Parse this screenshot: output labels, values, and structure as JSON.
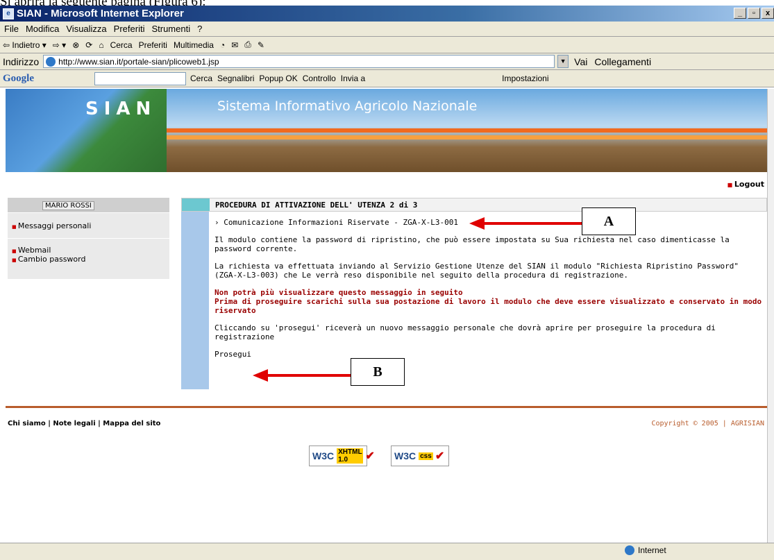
{
  "caption": "Si aprirà la seguente pagina (Figura 6):",
  "window": {
    "title": "SIAN - Microsoft Internet Explorer"
  },
  "menu": [
    "File",
    "Modifica",
    "Visualizza",
    "Preferiti",
    "Strumenti",
    "?"
  ],
  "toolbar": {
    "back": "⇦ Indietro ▾",
    "forward": "⇨ ▾",
    "search": "Cerca",
    "favorites": "Preferiti",
    "media": "Multimedia"
  },
  "address": {
    "label": "Indirizzo",
    "url": "http://www.sian.it/portale-sian/plicoweb1.jsp",
    "go": "Vai",
    "links": "Collegamenti"
  },
  "googlebar": {
    "logo": "Google",
    "search": "Cerca",
    "bookmarks": "Segnalibri",
    "popup": "Popup OK",
    "check": "Controllo",
    "send": "Invia a",
    "settings": "Impostazioni"
  },
  "banner": {
    "brand": "SIAN",
    "title": "Sistema Informativo Agricolo Nazionale"
  },
  "logout": "Logout",
  "sidebar": {
    "user": "MARIO ROSSI",
    "items": [
      "Messaggi personali",
      "Webmail",
      "Cambio password"
    ]
  },
  "main": {
    "heading": "PROCEDURA DI ATTIVAZIONE DELL' UTENZA 2 di 3",
    "doc_link": "Comunicazione Informazioni Riservate - ZGA-X-L3-001",
    "p1": "Il modulo contiene la password di ripristino, che può essere impostata su Sua richiesta nel caso dimenticasse la password corrente.",
    "p2": "La richiesta va effettuata inviando al Servizio Gestione Utenze del SIAN il modulo \"Richiesta Ripristino Password\" (ZGA-X-L3-003) che Le verrà reso disponibile nel seguito della procedura di registrazione.",
    "warn1": "Non potrà più visualizzare questo messaggio in seguito",
    "warn2": "Prima di proseguire scarichi sulla sua postazione di lavoro il modulo che deve essere visualizzato e conservato in modo riservato",
    "p3": "Cliccando su 'prosegui' riceverà un nuovo messaggio personale che dovrà aprire per proseguire la procedura di registrazione",
    "continue": "Prosegui"
  },
  "footer": {
    "links": "Chi siamo | Note legali | Mappa del sito",
    "copyright": "Copyright © 2005 | AGRISIAN"
  },
  "badges": {
    "xhtml": "W3C",
    "xhtml_tag": "XHTML 1.0",
    "css": "W3C",
    "css_tag": "css"
  },
  "status": {
    "zone": "Internet"
  },
  "callouts": {
    "a": "A",
    "b": "B"
  }
}
